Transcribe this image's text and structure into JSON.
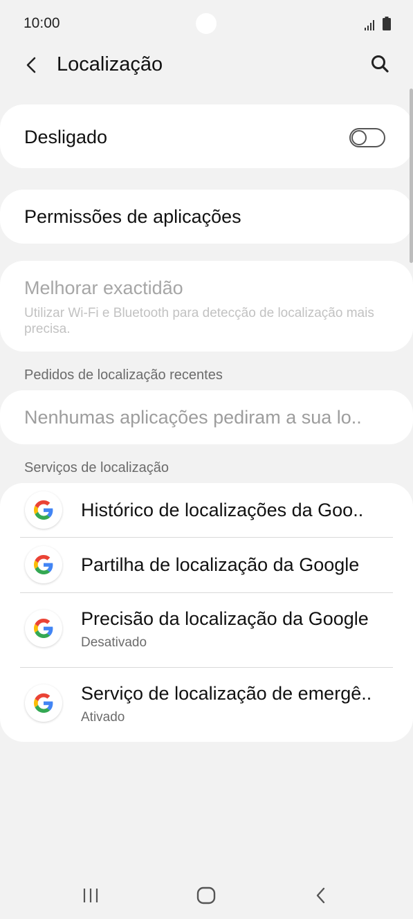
{
  "status_bar": {
    "time": "10:00"
  },
  "app_bar": {
    "title": "Localização"
  },
  "master_toggle": {
    "label": "Desligado",
    "state": "off"
  },
  "app_permissions": {
    "label": "Permissões de aplicações"
  },
  "improve_accuracy": {
    "title": "Melhorar exactidão",
    "subtitle": "Utilizar Wi-Fi e Bluetooth para detecção de localização mais precisa."
  },
  "recent_requests": {
    "header": "Pedidos de localização recentes",
    "empty_text": "Nenhumas aplicações pediram a sua lo.."
  },
  "location_services": {
    "header": "Serviços de localização",
    "items": [
      {
        "title": "Histórico de localizações da Goo..",
        "subtitle": ""
      },
      {
        "title": "Partilha de localização da Google",
        "subtitle": ""
      },
      {
        "title": "Precisão da localização da Google",
        "subtitle": "Desativado"
      },
      {
        "title": "Serviço de localização de emergê..",
        "subtitle": "Ativado"
      }
    ]
  },
  "icons": {
    "back": "back-arrow-icon",
    "search": "search-icon",
    "google": "google-g-icon",
    "signal": "signal-icon",
    "battery": "battery-icon",
    "nav_recents": "recents-icon",
    "nav_home": "home-icon",
    "nav_back": "nav-back-icon"
  },
  "colors": {
    "background": "#f2f2f2",
    "card": "#ffffff",
    "disabled_text": "#a6a6a6",
    "section_header": "#6b6b6b"
  }
}
